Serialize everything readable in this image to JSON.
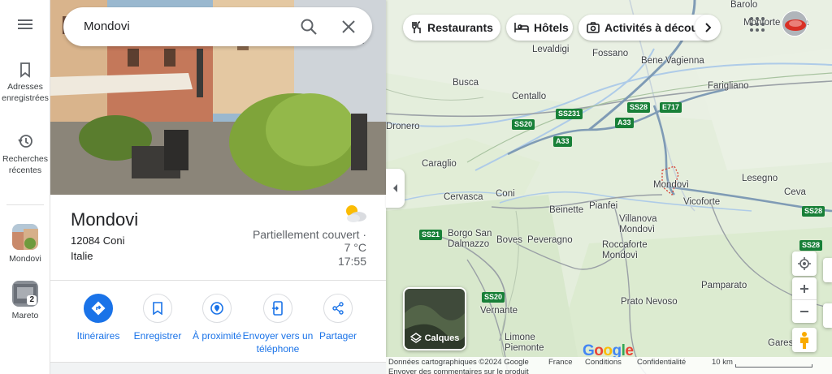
{
  "search": {
    "value": "Mondovi"
  },
  "rail": {
    "saved_label": "Adresses enregistrées",
    "recent_label": "Recherches récentes",
    "recent_items": [
      {
        "label": "Mondovi"
      },
      {
        "label": "Mareto",
        "badge": "2"
      }
    ]
  },
  "place": {
    "name": "Mondovi",
    "address_line1": "12084 Coni",
    "address_line2": "Italie",
    "weather_condition": "Partiellement couvert ·",
    "weather_temp": "7 °C",
    "weather_time": "17:55"
  },
  "actions": [
    {
      "label": "Itinéraires"
    },
    {
      "label": "Enregistrer"
    },
    {
      "label": "À proximité"
    },
    {
      "label": "Envoyer vers un téléphone"
    },
    {
      "label": "Partager"
    }
  ],
  "chips": [
    {
      "label": "Restaurants"
    },
    {
      "label": "Hôtels"
    },
    {
      "label": "Activités à découvrir"
    }
  ],
  "layers": {
    "label": "Calques"
  },
  "map": {
    "towns": [
      "Barolo",
      "Monforte d'Alba",
      "Levaldigi",
      "Fossano",
      "Bene Vagienna",
      "Busca",
      "Farigliano",
      "Centallo",
      "Dronero",
      "Caraglio",
      "Mondovì",
      "Lesegno",
      "Ceva",
      "Cervasca",
      "Coni",
      "Beinette",
      "Pianfei",
      "Vicoforte",
      "Villanova Mondovì",
      "Borgo San Dalmazzo",
      "Boves",
      "Peveragno",
      "Roccaforte Mondovì",
      "Pamparato",
      "Vernante",
      "Prato Nevoso",
      "Limone Piemonte",
      "Garessio",
      "Fossano"
    ],
    "roads": [
      "SS231",
      "SS20",
      "A33",
      "SS28",
      "E717",
      "A33",
      "SS21",
      "SS20",
      "SS28",
      "SS28"
    ]
  },
  "footer": {
    "data_label": "Données cartographiques ©2024 Google",
    "country": "France",
    "terms": "Conditions",
    "privacy": "Confidentialité",
    "scale": "10 km",
    "feedback": "Envoyer des commentaires sur le produit"
  },
  "logo": "Google"
}
